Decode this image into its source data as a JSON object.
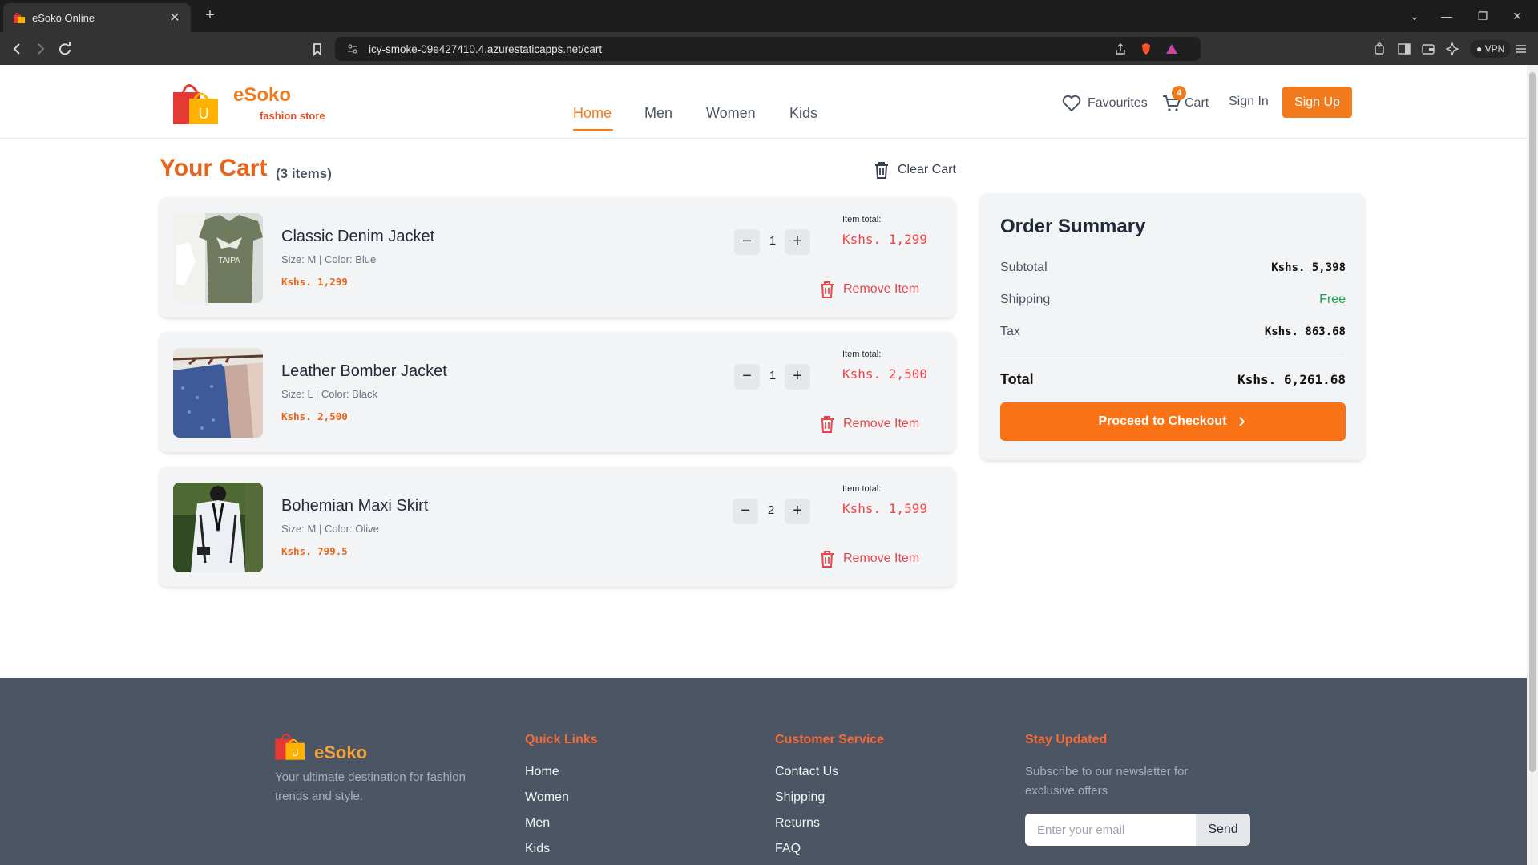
{
  "browser": {
    "tab_title": "eSoko Online",
    "url": "icy-smoke-09e427410.4.azurestaticapps.net/cart",
    "vpn_label": "VPN"
  },
  "header": {
    "brand_name": "eSoko",
    "brand_sub": "fashion store",
    "nav": [
      "Home",
      "Men",
      "Women",
      "Kids"
    ],
    "favourites": "Favourites",
    "cart": "Cart",
    "cart_count": "4",
    "sign_in": "Sign In",
    "sign_up": "Sign Up",
    "accent_color": "#f07a1c"
  },
  "cart": {
    "title": "Your Cart",
    "count": "(3 items)",
    "clear_label": "Clear Cart",
    "total_label": "Item total:",
    "remove_label": "Remove Item",
    "items": [
      {
        "name": "Classic Denim Jacket",
        "meta": "Size: M | Color: Blue",
        "price": "Kshs. 1,299",
        "qty": "1",
        "total": "Kshs. 1,299"
      },
      {
        "name": "Leather Bomber Jacket",
        "meta": "Size: L | Color: Black",
        "price": "Kshs. 2,500",
        "qty": "1",
        "total": "Kshs. 2,500"
      },
      {
        "name": "Bohemian Maxi Skirt",
        "meta": "Size: M | Color: Olive",
        "price": "Kshs. 799.5",
        "qty": "2",
        "total": "Kshs. 1,599"
      }
    ]
  },
  "summary": {
    "title": "Order Summary",
    "subtotal_label": "Subtotal",
    "subtotal": "Kshs. 5,398",
    "shipping_label": "Shipping",
    "shipping": "Free",
    "tax_label": "Tax",
    "tax": "Kshs. 863.68",
    "total_label": "Total",
    "total": "Kshs. 6,261.68",
    "checkout": "Proceed to Checkout"
  },
  "footer": {
    "brand": "eSoko",
    "description": "Your ultimate destination for fashion trends and style.",
    "quick_links_title": "Quick Links",
    "quick_links": [
      "Home",
      "Women",
      "Men",
      "Kids"
    ],
    "customer_service_title": "Customer Service",
    "customer_service": [
      "Contact Us",
      "Shipping",
      "Returns",
      "FAQ"
    ],
    "newsletter_title": "Stay Updated",
    "newsletter_text": "Subscribe to our newsletter for exclusive offers",
    "email_placeholder": "Enter your email",
    "send": "Send"
  }
}
